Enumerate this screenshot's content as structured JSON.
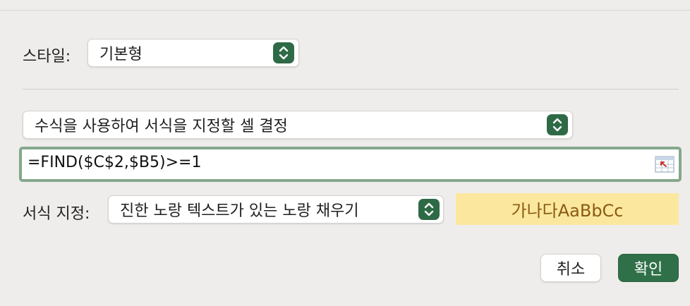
{
  "style": {
    "label": "스타일:",
    "value": "기본형"
  },
  "rule": {
    "value": "수식을 사용하여 서식을 지정할 셀 결정"
  },
  "formula": {
    "value": "=FIND($C$2,$B5)>=1"
  },
  "format": {
    "label": "서식 지정:",
    "value": "진한 노랑 텍스트가 있는 노랑 채우기",
    "preview_text": "가나다AaBbCc"
  },
  "buttons": {
    "cancel": "취소",
    "ok": "확인"
  },
  "icons": {
    "popup": "up-down-chevron-icon",
    "collapse": "collapse-dialog-icon"
  },
  "colors": {
    "accent": "#2e6a46",
    "preview_fill": "#fbe89e",
    "preview_text": "#8a5a14",
    "formula_focus": "#84a88c"
  }
}
